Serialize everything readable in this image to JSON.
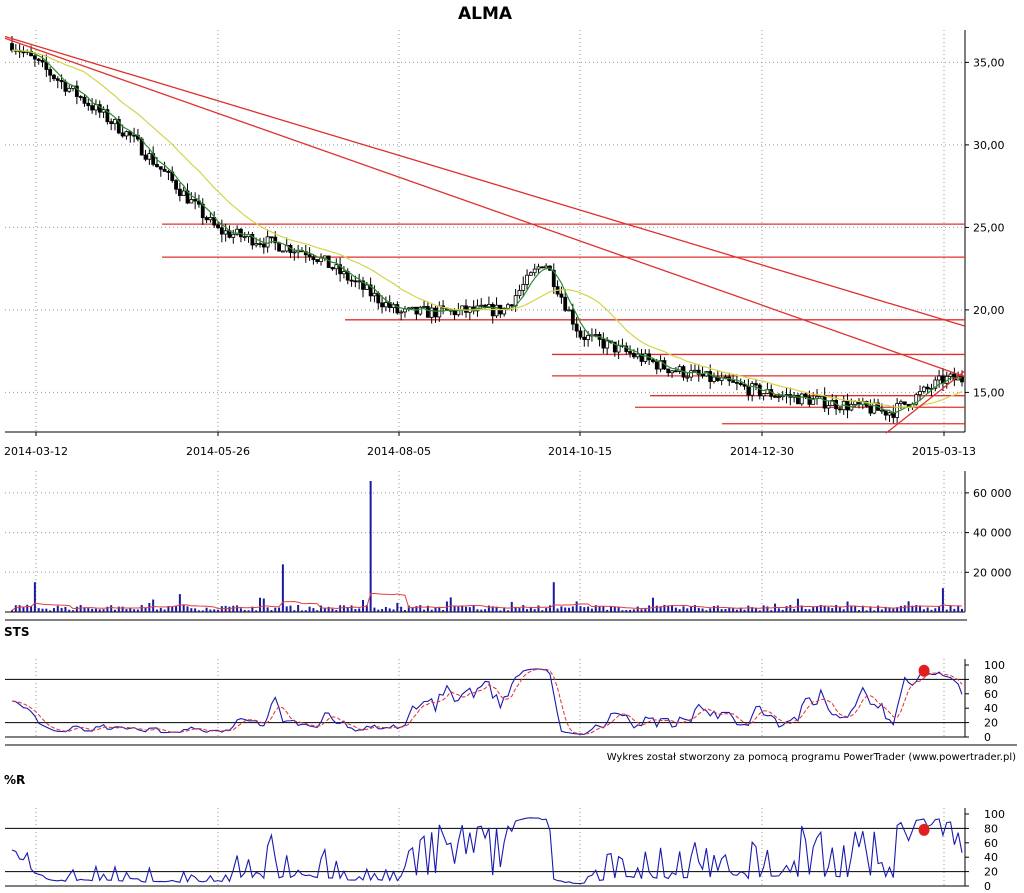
{
  "title": "ALMA",
  "credit": "Wykres został stworzony za pomocą programu PowerTrader (www.powertrader.pl)",
  "colors": {
    "up_candle": "#ffffff",
    "down_candle": "#000000",
    "sma_short": "#2e8b2e",
    "sma_long": "#d4d44a",
    "trend_line": "#e03030",
    "volume_bar": "#1a1aa0",
    "volume_avg": "#e04040",
    "osc_line": "#1a1ab0",
    "osc_signal": "#e03030",
    "marker": "#e02020",
    "grid": "#999999"
  },
  "chart_data": [
    {
      "type": "candlestick",
      "panel": "price",
      "ylim": [
        12.6,
        36.6
      ],
      "y_ticks": [
        "35,00",
        "30,00",
        "25,00",
        "20,00",
        "15,00"
      ],
      "y_tick_values": [
        35,
        30,
        25,
        20,
        15
      ],
      "x_ticks": [
        "2014-03-12",
        "2014-05-26",
        "2014-08-05",
        "2014-10-15",
        "2014-12-30",
        "2015-03-13"
      ],
      "grid": true,
      "key_closes": [
        {
          "date": "2014-03-12",
          "close": 35.0
        },
        {
          "date": "2014-04-20",
          "close": 30.5
        },
        {
          "date": "2014-05-26",
          "close": 24.8
        },
        {
          "date": "2014-07-01",
          "close": 23.5
        },
        {
          "date": "2014-08-05",
          "close": 19.8
        },
        {
          "date": "2014-09-15",
          "close": 20.0
        },
        {
          "date": "2014-10-01",
          "close": 23.0
        },
        {
          "date": "2014-10-15",
          "close": 18.5
        },
        {
          "date": "2014-11-20",
          "close": 16.5
        },
        {
          "date": "2014-12-30",
          "close": 15.0
        },
        {
          "date": "2015-02-20",
          "close": 13.8
        },
        {
          "date": "2015-03-13",
          "close": 15.8
        }
      ],
      "horizontal_levels": [
        25.2,
        23.2,
        19.4,
        17.3,
        16.0,
        14.8,
        14.1,
        13.1
      ],
      "trend_lines": [
        {
          "from": {
            "date": "2014-03-12",
            "value": 36.0
          },
          "to": {
            "date": "2015-03-13",
            "value": 19.4
          }
        },
        {
          "from": {
            "date": "2014-03-12",
            "value": 35.8
          },
          "to": {
            "date": "2015-03-13",
            "value": 16.4
          }
        },
        {
          "from": {
            "date": "2015-02-20",
            "value": 12.8
          },
          "to": {
            "date": "2015-03-13",
            "value": 15.3
          }
        }
      ]
    },
    {
      "type": "bar",
      "panel": "volume",
      "ylim": [
        0,
        68000
      ],
      "y_ticks": [
        "60 000",
        "40 000",
        "20 000"
      ],
      "y_tick_values": [
        60000,
        40000,
        20000
      ],
      "spikes": [
        {
          "date": "2014-03-12",
          "value": 15000
        },
        {
          "date": "2014-05-10",
          "value": 9000
        },
        {
          "date": "2014-06-20",
          "value": 24000
        },
        {
          "date": "2014-07-25",
          "value": 66000
        },
        {
          "date": "2014-10-05",
          "value": 15000
        },
        {
          "date": "2015-03-13",
          "value": 12000
        }
      ]
    },
    {
      "type": "line",
      "panel": "STS",
      "label": "STS",
      "ylim": [
        0,
        100
      ],
      "y_ticks": [
        "100",
        "80",
        "60",
        "40",
        "20",
        "0"
      ],
      "y_tick_values": [
        100,
        80,
        60,
        40,
        20,
        0
      ],
      "reference_levels": [
        80,
        20
      ],
      "marker": {
        "date": "2015-03-05",
        "value": 92
      }
    },
    {
      "type": "line",
      "panel": "%R",
      "label": "%R",
      "ylim": [
        0,
        100
      ],
      "y_ticks": [
        "100",
        "80",
        "60",
        "40",
        "20",
        "0"
      ],
      "y_tick_values": [
        100,
        80,
        60,
        40,
        20,
        0
      ],
      "reference_levels": [
        80,
        20
      ],
      "marker": {
        "date": "2015-03-05",
        "value": 78
      }
    }
  ]
}
